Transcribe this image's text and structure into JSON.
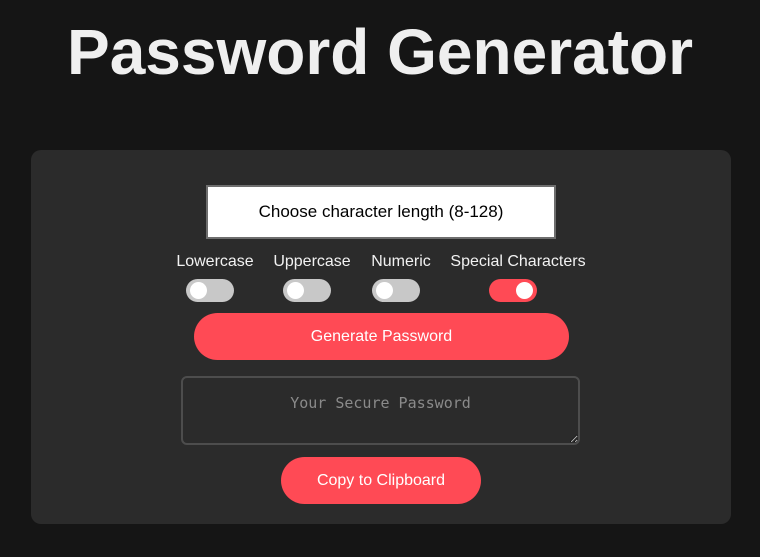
{
  "page": {
    "title": "Password Generator"
  },
  "length_input": {
    "placeholder": "Choose character length (8-128)",
    "value": ""
  },
  "options": [
    {
      "label": "Lowercase",
      "enabled": false
    },
    {
      "label": "Uppercase",
      "enabled": false
    },
    {
      "label": "Numeric",
      "enabled": false
    },
    {
      "label": "Special Characters",
      "enabled": true
    }
  ],
  "generate_button": {
    "label": "Generate Password"
  },
  "output": {
    "placeholder": "Your Secure Password",
    "value": ""
  },
  "copy_button": {
    "label": "Copy to Clipboard"
  },
  "colors": {
    "accent": "#ff4a55",
    "background": "#151515",
    "card": "#2b2b2b",
    "toggle_off": "#c8c8c8"
  }
}
